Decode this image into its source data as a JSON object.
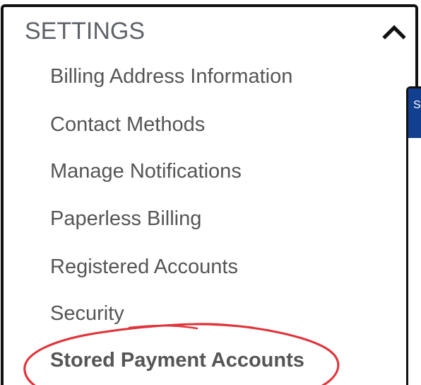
{
  "settings": {
    "title": "SETTINGS",
    "toggle_icon": "chevron-up-icon",
    "items": [
      {
        "label": "Billing Address Information",
        "active": false
      },
      {
        "label": "Contact Methods",
        "active": false
      },
      {
        "label": "Manage Notifications",
        "active": false
      },
      {
        "label": "Paperless Billing",
        "active": false
      },
      {
        "label": "Registered Accounts",
        "active": false
      },
      {
        "label": "Security",
        "active": false
      },
      {
        "label": "Stored Payment Accounts",
        "active": true
      }
    ]
  },
  "overlay_window": {
    "title_fragment": "S",
    "titlebar_color": "#123f8f"
  },
  "annotation": {
    "shape": "ellipse",
    "target": "Stored Payment Accounts",
    "color": "#e0343b"
  },
  "colors": {
    "text": "#5f6368",
    "border": "#111111"
  }
}
